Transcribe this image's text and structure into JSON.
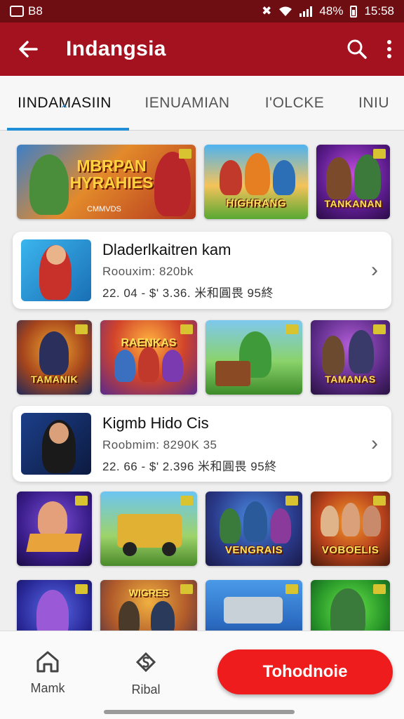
{
  "status_bar": {
    "left_text": "B8",
    "battery": "48%",
    "time": "15:58"
  },
  "app_bar": {
    "title": "Indangsia",
    "back_icon": "arrow-left-icon",
    "search_icon": "search-icon",
    "more_icon": "more-vert-icon"
  },
  "tabs": [
    {
      "label": "IINDAMASIIN",
      "active": true
    },
    {
      "label": "IENUAMIAN",
      "active": false
    },
    {
      "label": "I'OLCKE",
      "active": false
    },
    {
      "label": "INIU",
      "active": false
    }
  ],
  "banners": [
    {
      "label": "MBRPAN HYRAHIES",
      "sub": "CMMVDS"
    },
    {
      "label": "HIGHRANG"
    },
    {
      "label": "TANKANAN"
    }
  ],
  "cards": [
    {
      "name": "Dladerlkaitren kam",
      "meta": "Roouxim:  820bk",
      "price": "22. 04 - $'   3.36.  米和圓畏  95終"
    },
    {
      "name": "Kigmb Hido Cis",
      "meta": "Roobmim:  8290K   35",
      "price": "22. 66 - $'   2.396  米和圓畏  95終"
    }
  ],
  "grid_row_1": [
    {
      "label": "TAMANIK"
    },
    {
      "label": "RAENKAS"
    },
    {
      "label": ""
    },
    {
      "label": "TAMANAS"
    }
  ],
  "grid_row_2": [
    {
      "label": ""
    },
    {
      "label": ""
    },
    {
      "label": "VENGRAIS"
    },
    {
      "label": "VOBOELIS"
    }
  ],
  "grid_row_3": [
    {
      "label": ""
    },
    {
      "label": "WIGRES"
    },
    {
      "label": ""
    },
    {
      "label": ""
    }
  ],
  "bottom_nav": {
    "home_label": "Mamk",
    "home_icon": "home-icon",
    "second_label": "Ribal",
    "second_icon": "dollar-tag-icon",
    "cta_label": "Tohodnoie"
  },
  "colors": {
    "appbar": "#a3121e",
    "statusbar": "#6e0d12",
    "tab_indicator": "#1f8fd8",
    "cta": "#ee1c1c"
  }
}
